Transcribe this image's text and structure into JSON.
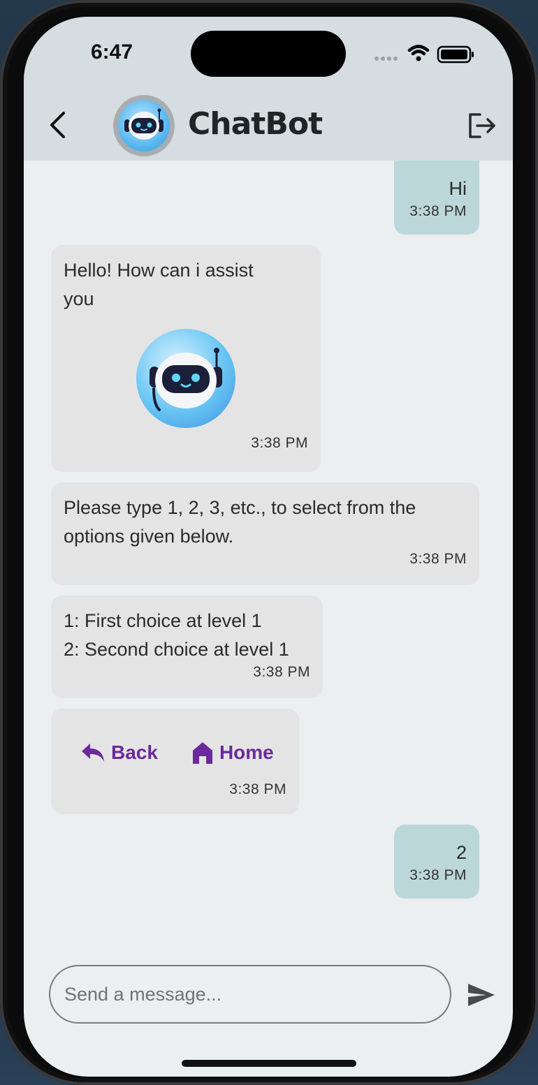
{
  "status_bar": {
    "time": "6:47"
  },
  "header": {
    "title": "ChatBot",
    "back_icon": "chevron-left-icon",
    "logout_icon": "logout-icon",
    "avatar_icon": "robot-icon"
  },
  "messages": [
    {
      "sender": "user",
      "text": "Hi",
      "time": "3:38 PM"
    },
    {
      "sender": "bot",
      "text": "Hello! How can i assist you",
      "image": "robot-icon",
      "time": "3:38 PM"
    },
    {
      "sender": "bot",
      "text": "Please type 1, 2, 3, etc., to select from the options given below.",
      "time": "3:38 PM"
    },
    {
      "sender": "bot",
      "lines": [
        "1: First choice at level 1",
        "2: Second choice at level 1"
      ],
      "time": "3:38 PM"
    },
    {
      "sender": "bot",
      "buttons": [
        {
          "label": "Back",
          "icon": "reply-icon"
        },
        {
          "label": "Home",
          "icon": "home-icon"
        }
      ],
      "time": "3:38 PM"
    },
    {
      "sender": "user",
      "text": "2",
      "time": "3:38 PM"
    }
  ],
  "composer": {
    "placeholder": "Send a message...",
    "value": ""
  },
  "colors": {
    "header_bg": "#d5dde1",
    "chat_bg": "#ebeff0",
    "user_bubble": "#bcd7da",
    "bot_bubble": "#e4e4e5",
    "accent": "#6a2a9b"
  }
}
